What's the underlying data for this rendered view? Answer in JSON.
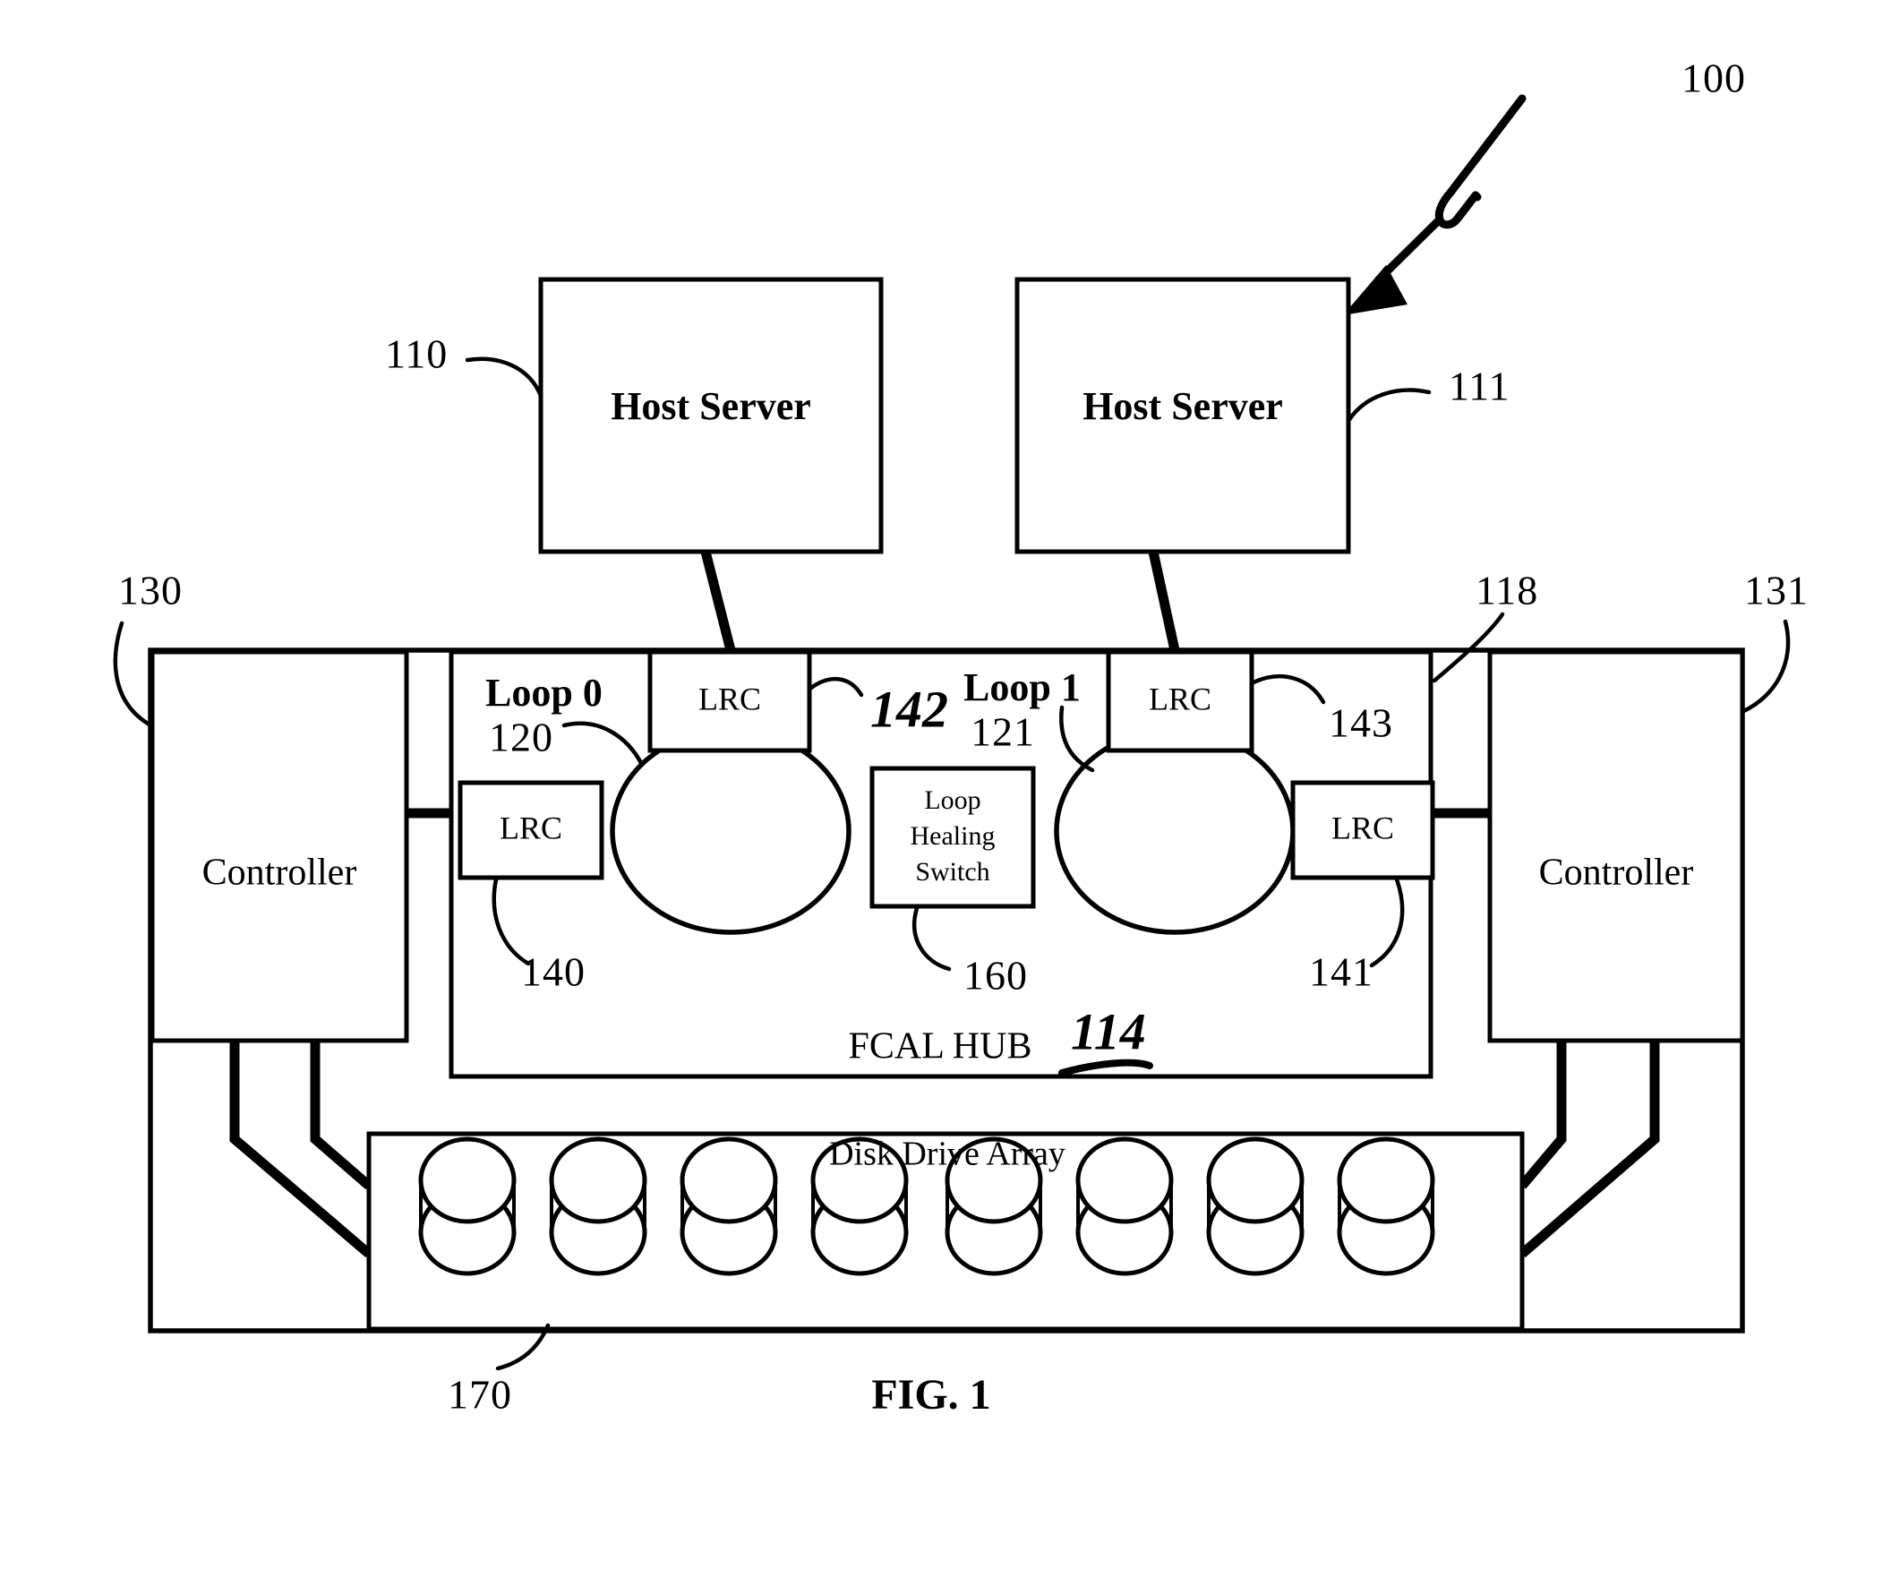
{
  "figure": {
    "caption": "FIG. 1",
    "system_ref": "100"
  },
  "hosts": [
    {
      "label": "Host Server",
      "ref": "110"
    },
    {
      "label": "Host Server",
      "ref": "111"
    }
  ],
  "controllers": [
    {
      "label": "Controller",
      "ref": "130"
    },
    {
      "label": "Controller",
      "ref": "131"
    }
  ],
  "enclosure": {
    "ref": "118"
  },
  "hub": {
    "label": "FCAL HUB",
    "ref_handwritten": "114"
  },
  "loops": [
    {
      "name": "Loop 0",
      "ref": "120"
    },
    {
      "name": "Loop 1",
      "ref": "121"
    }
  ],
  "lrcs": [
    {
      "label": "LRC",
      "ref": "140",
      "position": "left"
    },
    {
      "label": "LRC",
      "ref": "142",
      "ref_handwritten": true,
      "position": "top-left"
    },
    {
      "label": "LRC",
      "ref": "143",
      "position": "top-right"
    },
    {
      "label": "LRC",
      "ref": "141",
      "position": "right"
    }
  ],
  "switch": {
    "line1": "Loop",
    "line2": "Healing",
    "line3": "Switch",
    "ref": "160"
  },
  "disk_array": {
    "label": "Disk Drive Array",
    "ref": "170",
    "drive_count": 8
  },
  "colors": {
    "ink": "#000000",
    "paper": "#ffffff"
  }
}
